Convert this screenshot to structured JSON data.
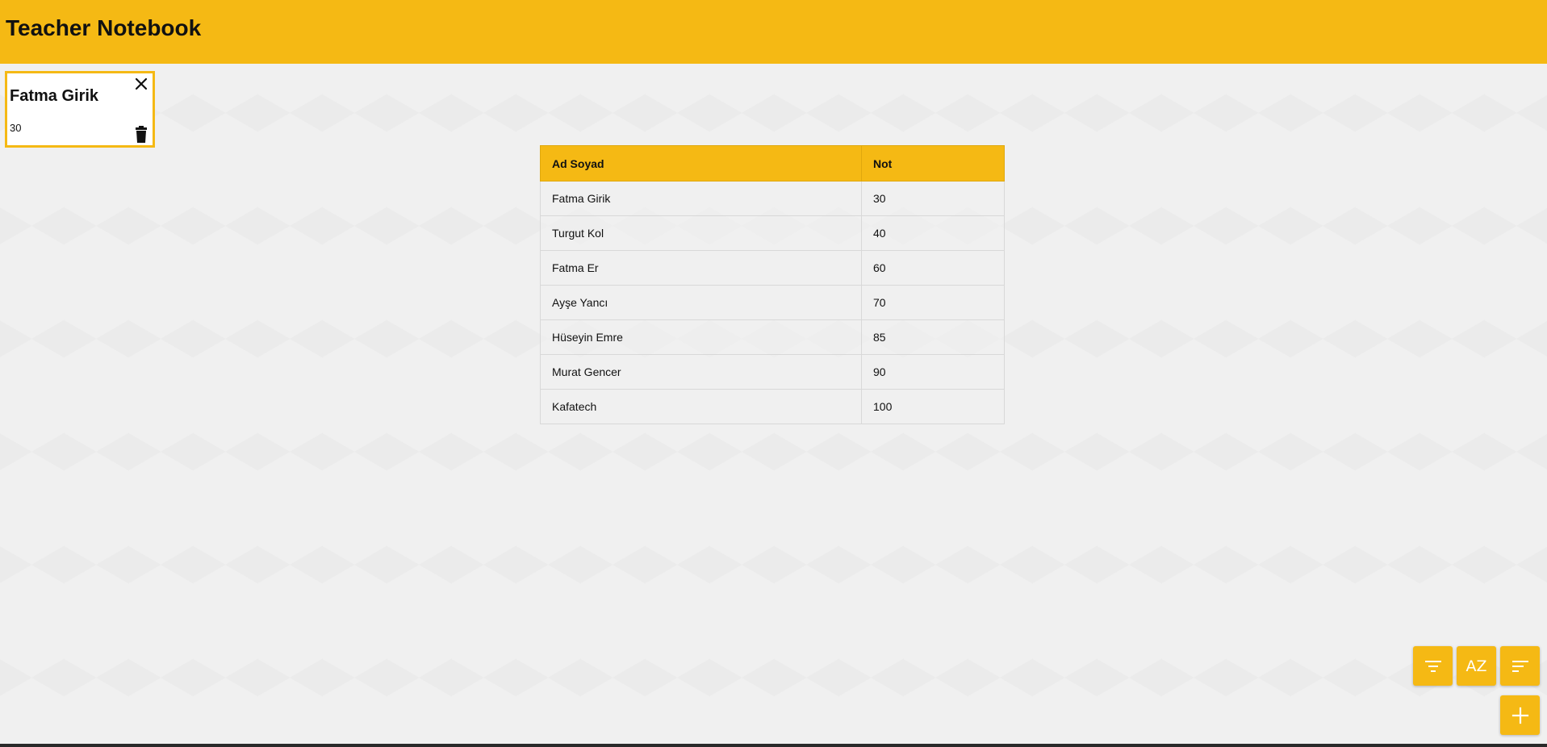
{
  "app": {
    "title": "Teacher Notebook"
  },
  "selected_card": {
    "name": "Fatma Girik",
    "grade": "30",
    "close_icon": "close-icon",
    "delete_icon": "trash-icon"
  },
  "table": {
    "headers": {
      "name": "Ad Soyad",
      "grade": "Not"
    },
    "rows": [
      {
        "name": "Fatma Girik",
        "grade": "30"
      },
      {
        "name": "Turgut Kol",
        "grade": "40"
      },
      {
        "name": "Fatma Er",
        "grade": "60"
      },
      {
        "name": "Ayşe Yancı",
        "grade": "70"
      },
      {
        "name": "Hüseyin Emre",
        "grade": "85"
      },
      {
        "name": "Murat Gencer",
        "grade": "90"
      },
      {
        "name": "Kafatech",
        "grade": "100"
      }
    ]
  },
  "actions": {
    "filter_icon": "filter-icon",
    "az_label": "AZ",
    "sort_icon": "sort-icon",
    "add_icon": "plus-icon"
  },
  "colors": {
    "accent": "#f5b914",
    "background": "#f0f0f0",
    "card_background": "#ffffff"
  }
}
